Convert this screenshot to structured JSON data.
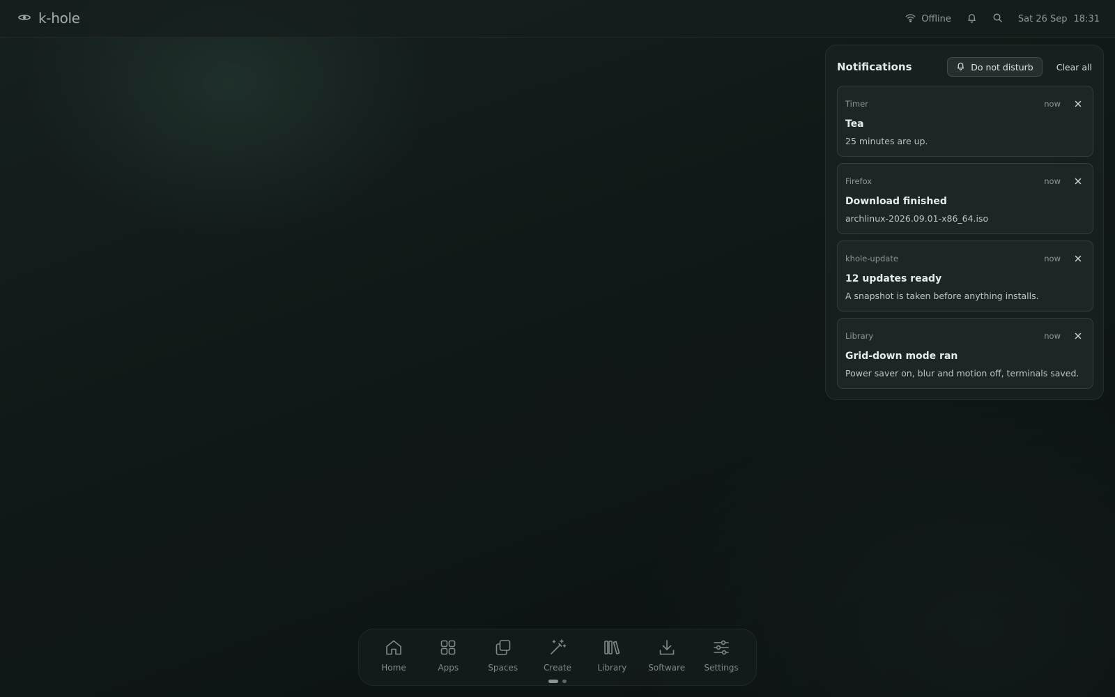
{
  "topbar": {
    "brand": "k-hole",
    "network_status": "Offline",
    "date": "Sat 26 Sep",
    "time": "18:31"
  },
  "notifications": {
    "title": "Notifications",
    "dnd_label": "Do not disturb",
    "clear_label": "Clear all",
    "items": [
      {
        "app": "Timer",
        "time": "now",
        "title": "Tea",
        "body": "25 minutes are up."
      },
      {
        "app": "Firefox",
        "time": "now",
        "title": "Download finished",
        "body": "archlinux-2026.09.01-x86_64.iso"
      },
      {
        "app": "khole-update",
        "time": "now",
        "title": "12 updates ready",
        "body": "A snapshot is taken before anything installs."
      },
      {
        "app": "Library",
        "time": "now",
        "title": "Grid-down mode ran",
        "body": "Power saver on, blur and motion off, terminals saved."
      }
    ]
  },
  "dock": {
    "items": [
      {
        "label": "Home",
        "icon": "home-icon"
      },
      {
        "label": "Apps",
        "icon": "apps-grid-icon"
      },
      {
        "label": "Spaces",
        "icon": "spaces-icon"
      },
      {
        "label": "Create",
        "icon": "magic-wand-icon"
      },
      {
        "label": "Library",
        "icon": "library-books-icon"
      },
      {
        "label": "Software",
        "icon": "download-icon"
      },
      {
        "label": "Settings",
        "icon": "sliders-icon"
      }
    ],
    "pages": 2,
    "active_page": 1
  }
}
